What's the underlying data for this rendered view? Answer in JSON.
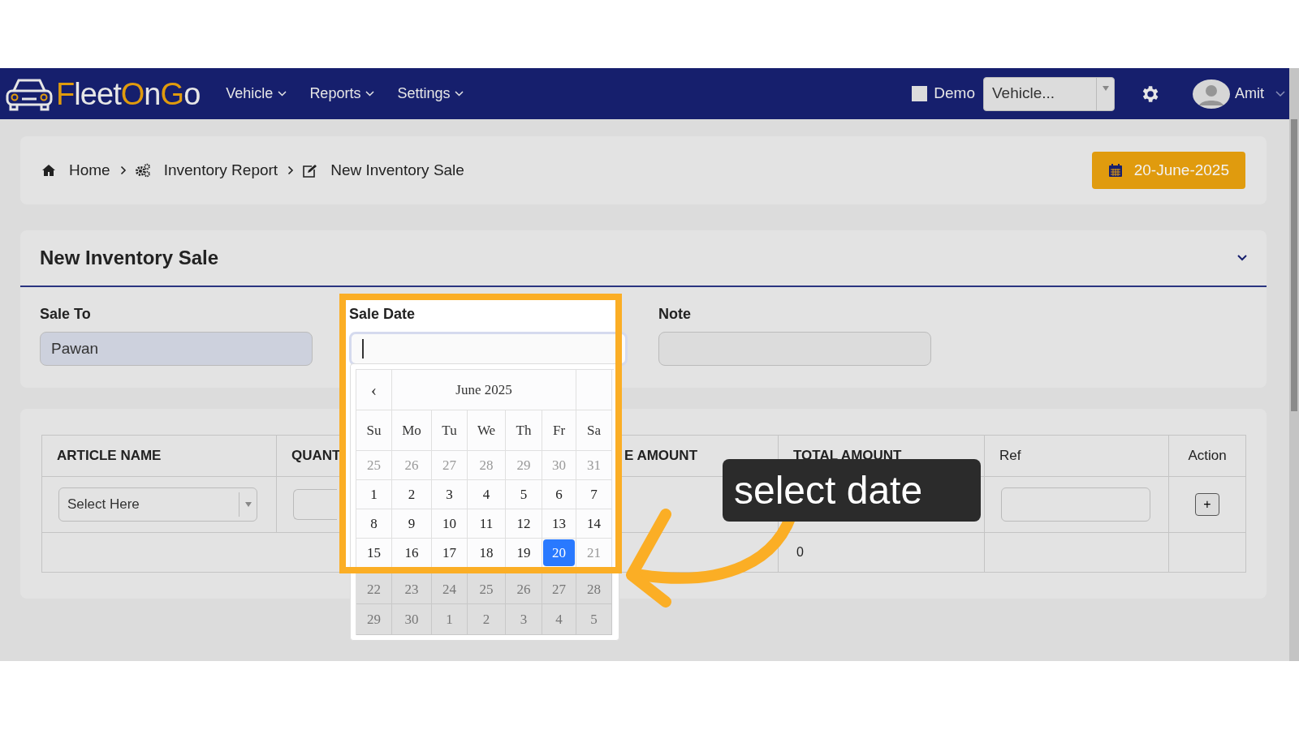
{
  "navbar": {
    "logo": [
      {
        "text": "F",
        "accent": true
      },
      {
        "text": "leet",
        "accent": false
      },
      {
        "text": "O",
        "accent": true
      },
      {
        "text": "n",
        "accent": false
      },
      {
        "text": "G",
        "accent": true
      },
      {
        "text": "o",
        "accent": false
      }
    ],
    "menus": [
      {
        "label": "Vehicle"
      },
      {
        "label": "Reports"
      },
      {
        "label": "Settings"
      }
    ],
    "demo": {
      "label": "Demo",
      "checked": false
    },
    "vehicle_select": {
      "value": "Vehicle..."
    },
    "user": {
      "name": "Amit"
    }
  },
  "breadcrumb": [
    {
      "label": "Home"
    },
    {
      "label": "Inventory Report"
    },
    {
      "label": "New Inventory Sale"
    }
  ],
  "date_badge": "20-June-2025",
  "form": {
    "title": "New Inventory Sale",
    "sale_to": {
      "label": "Sale To",
      "value": "Pawan"
    },
    "sale_date": {
      "label": "Sale Date",
      "focused": true
    },
    "note": {
      "label": "Note"
    }
  },
  "datepicker": {
    "prev": "‹",
    "month": "June 2025",
    "weekdays": [
      "Su",
      "Mo",
      "Tu",
      "We",
      "Th",
      "Fr",
      "Sa"
    ],
    "weeks": [
      [
        {
          "day": "25",
          "muted": true,
          "selected": false
        },
        {
          "day": "26",
          "muted": true,
          "selected": false
        },
        {
          "day": "27",
          "muted": true,
          "selected": false
        },
        {
          "day": "28",
          "muted": true,
          "selected": false
        },
        {
          "day": "29",
          "muted": true,
          "selected": false
        },
        {
          "day": "30",
          "muted": true,
          "selected": false
        },
        {
          "day": "31",
          "muted": true,
          "selected": false
        }
      ],
      [
        {
          "day": "1",
          "muted": false,
          "selected": false
        },
        {
          "day": "2",
          "muted": false,
          "selected": false
        },
        {
          "day": "3",
          "muted": false,
          "selected": false
        },
        {
          "day": "4",
          "muted": false,
          "selected": false
        },
        {
          "day": "5",
          "muted": false,
          "selected": false
        },
        {
          "day": "6",
          "muted": false,
          "selected": false
        },
        {
          "day": "7",
          "muted": false,
          "selected": false
        }
      ],
      [
        {
          "day": "8",
          "muted": false,
          "selected": false
        },
        {
          "day": "9",
          "muted": false,
          "selected": false
        },
        {
          "day": "10",
          "muted": false,
          "selected": false
        },
        {
          "day": "11",
          "muted": false,
          "selected": false
        },
        {
          "day": "12",
          "muted": false,
          "selected": false
        },
        {
          "day": "13",
          "muted": false,
          "selected": false
        },
        {
          "day": "14",
          "muted": false,
          "selected": false
        }
      ],
      [
        {
          "day": "15",
          "muted": false,
          "selected": false
        },
        {
          "day": "16",
          "muted": false,
          "selected": false
        },
        {
          "day": "17",
          "muted": false,
          "selected": false
        },
        {
          "day": "18",
          "muted": false,
          "selected": false
        },
        {
          "day": "19",
          "muted": false,
          "selected": false
        },
        {
          "day": "20",
          "muted": false,
          "selected": true
        },
        {
          "day": "21",
          "muted": true,
          "selected": false
        }
      ],
      [
        {
          "day": "22",
          "muted": true,
          "selected": false
        },
        {
          "day": "23",
          "muted": true,
          "selected": false
        },
        {
          "day": "24",
          "muted": true,
          "selected": false
        },
        {
          "day": "25",
          "muted": true,
          "selected": false
        },
        {
          "day": "26",
          "muted": true,
          "selected": false
        },
        {
          "day": "27",
          "muted": true,
          "selected": false
        },
        {
          "day": "28",
          "muted": true,
          "selected": false
        }
      ],
      [
        {
          "day": "29",
          "muted": true,
          "selected": false
        },
        {
          "day": "30",
          "muted": true,
          "selected": false
        },
        {
          "day": "1",
          "muted": true,
          "selected": false
        },
        {
          "day": "2",
          "muted": true,
          "selected": false
        },
        {
          "day": "3",
          "muted": true,
          "selected": false
        },
        {
          "day": "4",
          "muted": true,
          "selected": false
        },
        {
          "day": "5",
          "muted": true,
          "selected": false
        }
      ]
    ]
  },
  "table": {
    "columns": [
      "ARTICLE NAME",
      "QUANT",
      "E AMOUNT",
      "TOTAL AMOUNT",
      "Ref",
      "Action"
    ],
    "row": {
      "article_placeholder": "Select Here",
      "add_button": "+"
    },
    "total_row": {
      "total_amount": "0"
    }
  },
  "callout": "select date"
}
